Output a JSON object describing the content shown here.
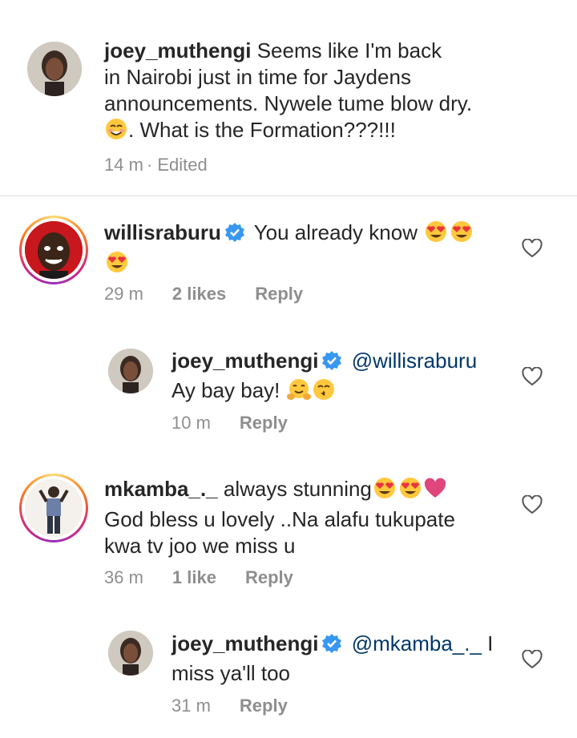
{
  "caption": {
    "username": "joey_muthengi",
    "text_line1": "Seems like  I'm back",
    "text_line2": "in Nairobi just in time for Jaydens",
    "text_line3": "announcements. Nywele tume blow dry.",
    "text_line4": ". What is the  Formation???!!!",
    "emoji": "smiling-face-icon",
    "time": "14 m",
    "edited": "· Edited"
  },
  "comments": [
    {
      "username": "willisraburu",
      "verified": true,
      "text": "You already know",
      "emojis": [
        "heart-eyes-icon",
        "heart-eyes-icon",
        "heart-eyes-icon"
      ],
      "time": "29 m",
      "likes": "2 likes",
      "reply": "Reply",
      "replies": [
        {
          "username": "joey_muthengi",
          "verified": true,
          "mention": "@willisraburu",
          "text": "Ay bay bay!",
          "emojis": [
            "hugging-face-icon",
            "kissing-face-icon"
          ],
          "time": "10 m",
          "reply": "Reply"
        }
      ]
    },
    {
      "username": "mkamba_._",
      "verified": false,
      "text_line1": "always stunning",
      "text_line2": "God bless u lovely ..Na alafu tukupate",
      "text_line3": "kwa tv joo we miss u",
      "emojis": [
        "heart-eyes-icon",
        "heart-eyes-icon",
        "heart-icon"
      ],
      "time": "36 m",
      "likes": "1 like",
      "reply": "Reply",
      "replies": [
        {
          "username": "joey_muthengi",
          "verified": true,
          "mention": "@mkamba_._",
          "text_tail": " I",
          "text_line2": "miss ya'll too",
          "time": "31 m",
          "reply": "Reply"
        }
      ]
    }
  ],
  "colors": {
    "text": "#262626",
    "meta": "#8e8e8e",
    "mention": "#00376b",
    "verified": "#3897f0",
    "heart_pink": "#e0457b"
  }
}
